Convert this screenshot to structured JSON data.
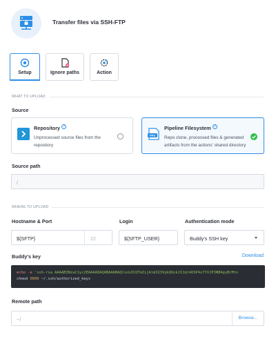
{
  "header": {
    "title": "Transfer files via SSH-FTP",
    "icon": "sftp-server-icon"
  },
  "tabs": [
    {
      "label": "Setup",
      "icon": "setup-gear-icon",
      "active": true
    },
    {
      "label": "Ignore paths",
      "icon": "ignore-file-icon",
      "active": false
    },
    {
      "label": "Action",
      "icon": "action-gear-icon",
      "active": false
    }
  ],
  "sections": {
    "what_to_upload": "WHAT TO UPLOAD",
    "where_to_upload": "WHERE TO UPLOAD"
  },
  "source": {
    "label": "Source",
    "options": [
      {
        "title": "Repository",
        "description_line1": "Unprocessed source files from the",
        "description_line2": "repository",
        "selected": false
      },
      {
        "title": "Pipeline Filesystem",
        "description_line1": "Repo clone, processed files & generated",
        "description_line2": "artifacts from the actions' shared directory",
        "selected": true
      }
    ],
    "help_glyph": "?"
  },
  "source_path": {
    "label": "Source path",
    "value": "/"
  },
  "hostname": {
    "label": "Hostname & Port",
    "value": "${SFTP}",
    "port_placeholder": "22"
  },
  "login": {
    "label": "Login",
    "value": "${SFTP_USER}"
  },
  "auth": {
    "label": "Authentication mode",
    "value": "Buddy's SSH key"
  },
  "buddy_key": {
    "label": "Buddy's key",
    "download": "Download",
    "line1_cmd": "echo -e ",
    "line1_str": "'ssh-rsa AAAAB3NzaC1yc2EAAAADAQABAAABAQCxoG3CQTmZijAlmSI3VqkQUskJIJqt4OSP4x7YXJPINB4pyBrMtx",
    "line2_cmd": "chmod ",
    "line2_num": "0600",
    "line2_rest": " ~/.ssh/authorized_keys"
  },
  "remote_path": {
    "label": "Remote path",
    "value": "~/",
    "browse": "Browse..."
  },
  "colors": {
    "accent": "#2c8ee6",
    "success": "#2fbf4c",
    "code_bg": "#2a2d34"
  }
}
